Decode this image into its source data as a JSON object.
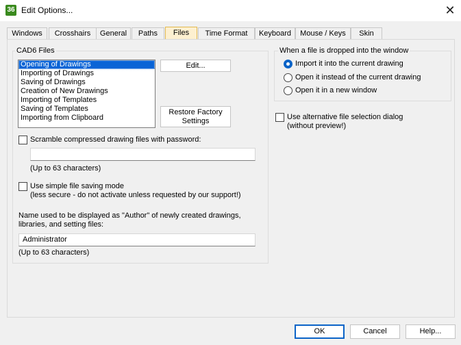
{
  "window": {
    "icon_text": "36",
    "title": "Edit Options...",
    "close_glyph": "✕"
  },
  "tabs": [
    {
      "label": "Windows"
    },
    {
      "label": "Crosshairs"
    },
    {
      "label": "General"
    },
    {
      "label": "Paths"
    },
    {
      "label": "Files",
      "active": true
    },
    {
      "label": "Time Format"
    },
    {
      "label": "Keyboard"
    },
    {
      "label": "Mouse / Keys"
    },
    {
      "label": "Skin"
    }
  ],
  "cad6_files": {
    "legend": "CAD6 Files",
    "items": [
      "Opening of Drawings",
      "Importing of Drawings",
      "Saving of Drawings",
      "Creation of New Drawings",
      "Importing of Templates",
      "Saving of Templates",
      "Importing from Clipboard"
    ],
    "selected_index": 0,
    "edit_button": "Edit...",
    "restore_button_line1": "Restore Factory",
    "restore_button_line2": "Settings"
  },
  "scramble": {
    "label": "Scramble compressed drawing files with password:",
    "password_value": "",
    "hint": "(Up to 63 characters)",
    "checked": false
  },
  "simple_saving": {
    "label_line1": "Use simple file saving mode",
    "label_line2": "(less secure - do not activate unless requested by our support!)",
    "checked": false
  },
  "author": {
    "label_line1": "Name used to be displayed as \"Author\" of newly created drawings,",
    "label_line2": "libraries, and setting files:",
    "value": "Administrator",
    "hint": "(Up to 63 characters)"
  },
  "drop_group": {
    "legend": "When a file is dropped into the window",
    "options": [
      {
        "label": "Import it into the current drawing",
        "checked": true
      },
      {
        "label": "Open it instead of the current drawing",
        "checked": false
      },
      {
        "label": "Open it in a new window",
        "checked": false
      }
    ]
  },
  "alt_dialog": {
    "label_line1": "Use alternative file selection dialog",
    "label_line2": "(without preview!)",
    "checked": false
  },
  "footer": {
    "ok": "OK",
    "cancel": "Cancel",
    "help": "Help..."
  }
}
